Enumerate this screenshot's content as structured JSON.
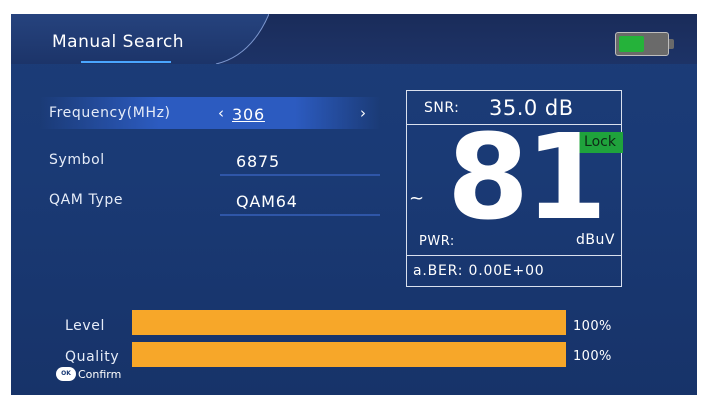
{
  "header": {
    "title": "Manual Search",
    "battery": {
      "level": 0.55,
      "fill_color": "#25b23a",
      "icon": "battery-icon"
    }
  },
  "fields": [
    {
      "label": "Frequency(MHz)",
      "value": "306",
      "selected": true,
      "prev_glyph": "‹",
      "next_glyph": "›"
    },
    {
      "label": "Symbol",
      "value": "6875"
    },
    {
      "label": "QAM Type",
      "value": "QAM64"
    }
  ],
  "signal": {
    "snr_label": "SNR:",
    "snr_value": "35.0 dB",
    "lock": "Lock",
    "power_value": "81",
    "tilde": "~",
    "pwr_label": "PWR:",
    "unit": "dBuV",
    "ber": "a.BER: 0.00E+00"
  },
  "bars": [
    {
      "label": "Level",
      "percent": 100,
      "percent_text": "100%",
      "color": "#f7a729"
    },
    {
      "label": "Quality",
      "percent": 100,
      "percent_text": "100%",
      "color": "#f7a729"
    }
  ],
  "footer": {
    "ok_badge": "OK",
    "confirm_label": "Confirm"
  },
  "colors": {
    "background": "#1a3a75",
    "selection": "#2c5bc0",
    "lock": "#1fa33c",
    "bar": "#f7a729"
  }
}
